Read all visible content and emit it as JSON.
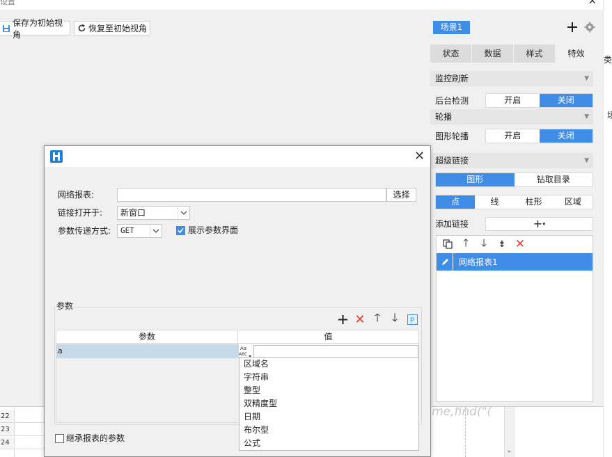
{
  "settings": {
    "title": "设置",
    "save_view": "保存为初始视角",
    "restore_view": "恢复至初始视角",
    "scene": "场景1"
  },
  "tabs": [
    {
      "label": "状态"
    },
    {
      "label": "数据"
    },
    {
      "label": "样式"
    },
    {
      "label": "特效"
    }
  ],
  "monitor": {
    "section": "监控刷新",
    "row_label": "后台检测",
    "on": "开启",
    "off": "关闭"
  },
  "carousel": {
    "section": "轮播",
    "row_label": "图形轮播",
    "on": "开启",
    "off": "关闭"
  },
  "hyperlink": {
    "section": "超级链接",
    "target_tabs": [
      "图形",
      "钻取目录"
    ],
    "element_tabs": [
      "点",
      "线",
      "柱形",
      "区域"
    ],
    "add_label": "添加链接",
    "items": [
      "网络报表1"
    ]
  },
  "dialog": {
    "report_label": "网络报表:",
    "report_value": "",
    "choose_button": "选择",
    "open_in_label": "链接打开于:",
    "open_in_value": "新窗口",
    "method_label": "参数传递方式:",
    "method_value": "GET",
    "show_params_label": "展示参数界面",
    "show_params_checked": true,
    "params_group_label": "参数",
    "col_param": "参数",
    "col_value": "值",
    "rows": [
      {
        "param": "a",
        "value": ""
      }
    ],
    "type_options": [
      "区域名",
      "字符串",
      "整型",
      "双精度型",
      "日期",
      "布尔型",
      "公式"
    ],
    "inherit_label": "继承报表的参数",
    "inherit_checked": false
  },
  "background": {
    "row_numbers": [
      "22",
      "23",
      "24"
    ],
    "right_fragments": [
      "类",
      "场"
    ],
    "formula_fragment": "me,find(\"("
  },
  "colors": {
    "accent": "#3f8de6",
    "panel_bg": "#f0f0f0",
    "danger": "#e53935"
  }
}
